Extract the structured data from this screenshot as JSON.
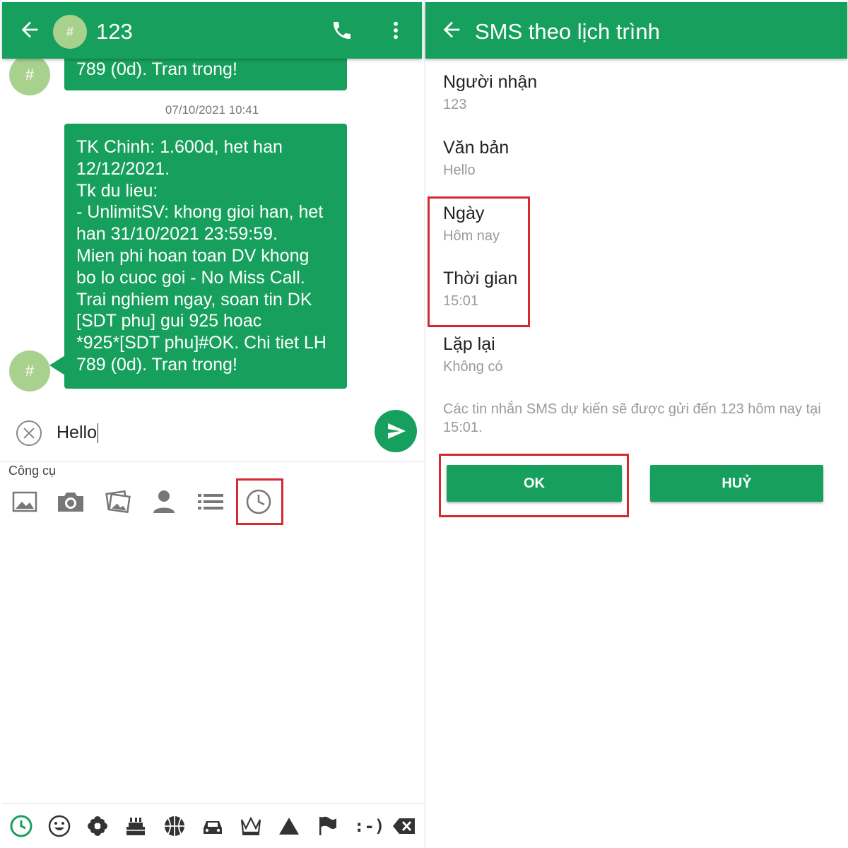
{
  "left": {
    "header": {
      "avatar_symbol": "#",
      "title": "123"
    },
    "messages": {
      "top_tail_text": "789 (0d). Tran trong!",
      "avatar_symbol": "#",
      "timestamp": "07/10/2021 10:41",
      "main_text": "TK Chinh: 1.600d, het han\n12/12/2021.\nTk du lieu:\n-  UnlimitSV: khong gioi han, het\nhan 31/10/2021 23:59:59.\nMien phi hoan toan DV khong\nbo lo cuoc goi - No Miss Call.\nTrai nghiem ngay, soan tin DK\n[SDT phu] gui 925 hoac\n*925*[SDT phu]#OK. Chi tiet LH\n789 (0d). Tran trong!"
    },
    "composer": {
      "text": "Hello"
    },
    "tools": {
      "label": "Công cụ"
    },
    "emoji_bar": {
      "emoticon_text": ":-)"
    },
    "colors": {
      "accent": "#17a05d",
      "avatar": "#a9d18e",
      "highlight": "#d42a2f"
    }
  },
  "right": {
    "header": {
      "title": "SMS theo lịch trình"
    },
    "fields": {
      "recipient": {
        "label": "Người nhận",
        "value": "123"
      },
      "text": {
        "label": "Văn bản",
        "value": "Hello"
      },
      "date": {
        "label": "Ngày",
        "value": "Hôm nay"
      },
      "time": {
        "label": "Thời gian",
        "value": "15:01"
      },
      "repeat": {
        "label": "Lặp lại",
        "value": "Không có"
      }
    },
    "info": "Các tin nhắn SMS dự kiến sẽ được gửi đến 123 hôm nay tại 15:01.",
    "buttons": {
      "ok": "OK",
      "cancel": "HUỶ"
    }
  }
}
